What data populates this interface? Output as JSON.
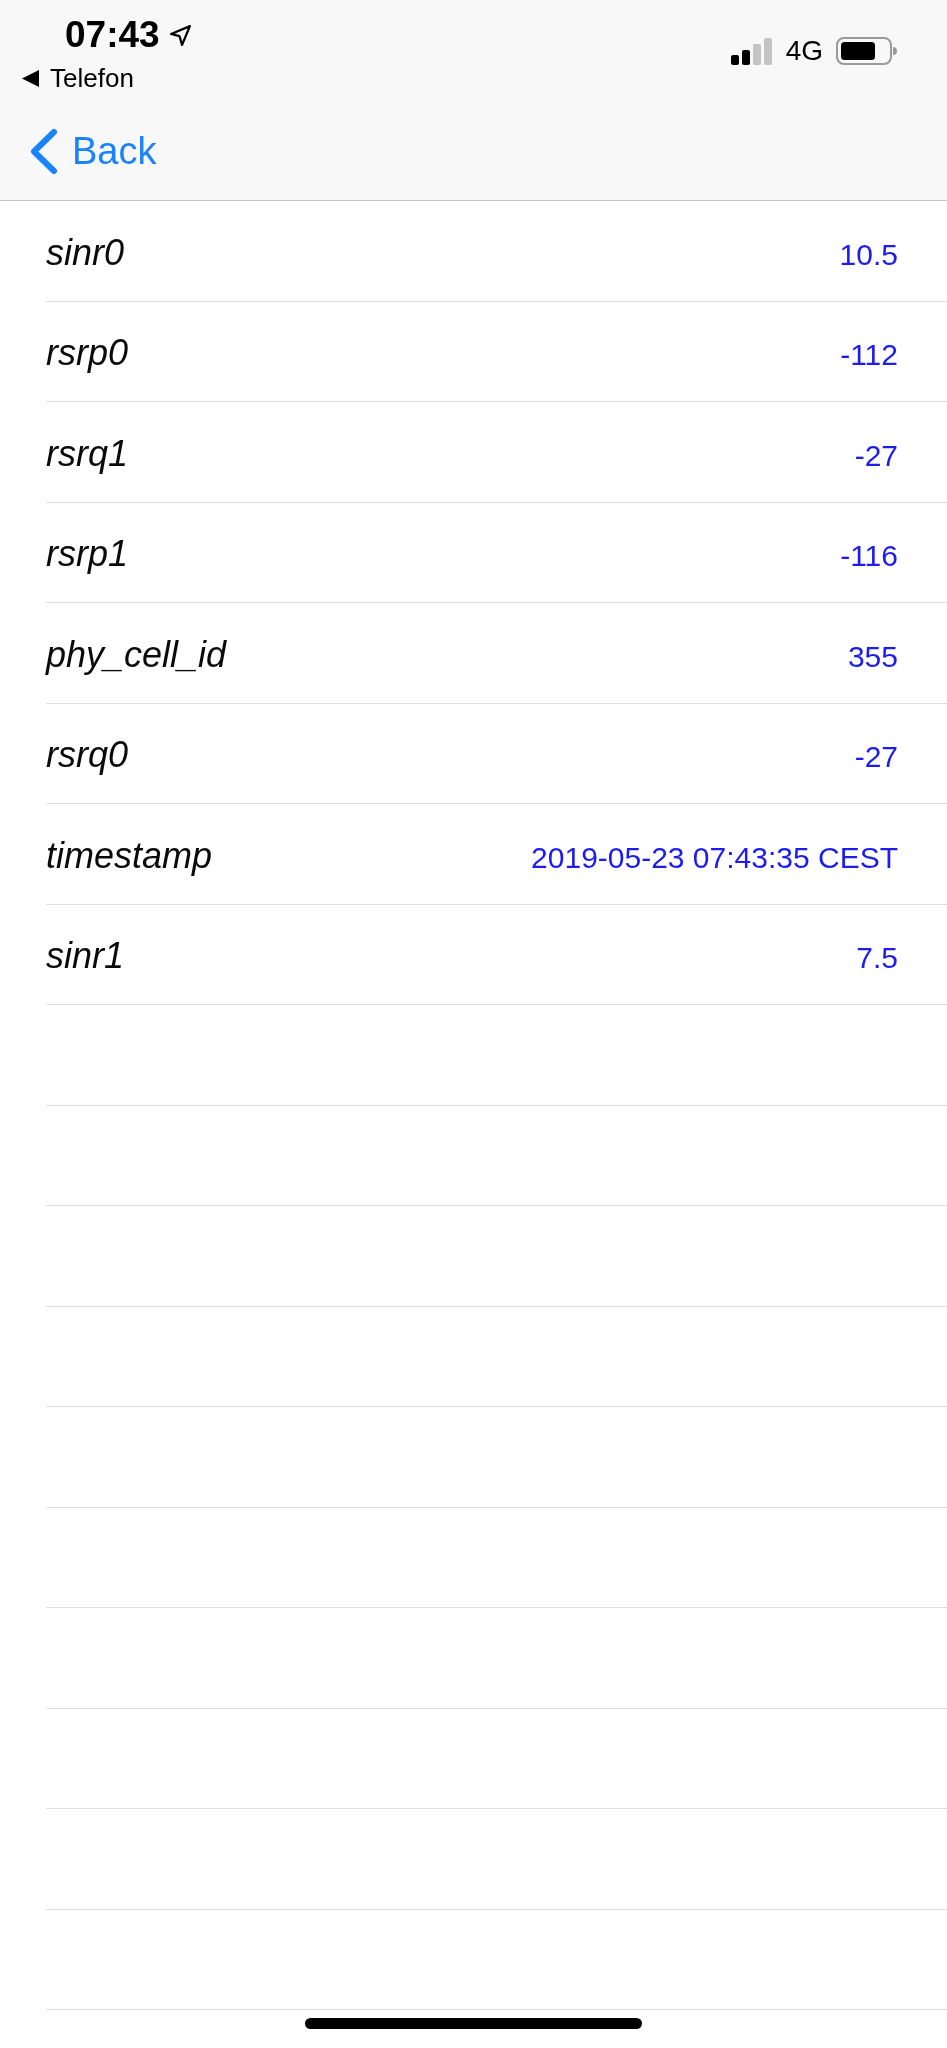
{
  "status_bar": {
    "time": "07:43",
    "back_to_app": "Telefon",
    "network": "4G"
  },
  "nav": {
    "back": "Back"
  },
  "rows": [
    {
      "label": "sinr0",
      "value": "10.5"
    },
    {
      "label": "rsrp0",
      "value": "-112"
    },
    {
      "label": "rsrq1",
      "value": "-27"
    },
    {
      "label": "rsrp1",
      "value": "-116"
    },
    {
      "label": "phy_cell_id",
      "value": "355"
    },
    {
      "label": "rsrq0",
      "value": "-27"
    },
    {
      "label": "timestamp",
      "value": "2019-05-23 07:43:35 CEST"
    },
    {
      "label": "sinr1",
      "value": "7.5"
    }
  ]
}
